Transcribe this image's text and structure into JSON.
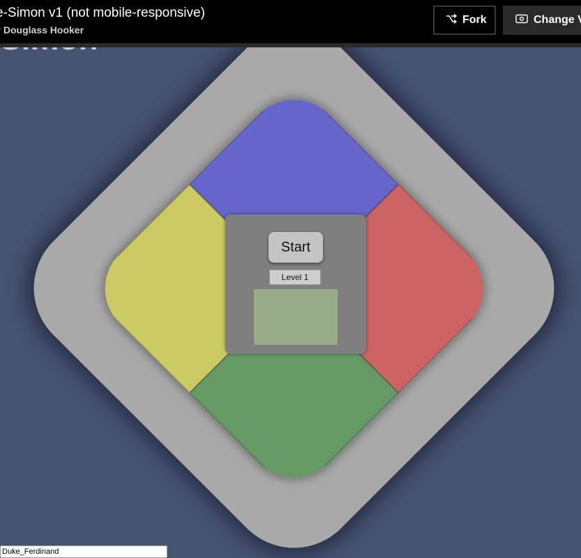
{
  "header": {
    "pen_title": "e-Simon v1 (not mobile-responsive)",
    "author_prefix": "y",
    "author_name": "Douglass Hooker",
    "fork_label": "Fork",
    "change_view_label": "Change Vie"
  },
  "page": {
    "heading": "Simon"
  },
  "game": {
    "start_label": "Start",
    "level_label": "Level 1",
    "colors": {
      "blue": "#6565cc",
      "red": "#cc6464",
      "yellow": "#cbca64",
      "green": "#659a65",
      "board": "#a9a9a9",
      "center": "#7f7f7f",
      "display": "#97ab89",
      "background": "#465472"
    }
  },
  "footer": {
    "name_value": "Duke_Ferdinand"
  },
  "icons": {
    "fork": "fork-icon",
    "change_view": "eye-icon"
  }
}
